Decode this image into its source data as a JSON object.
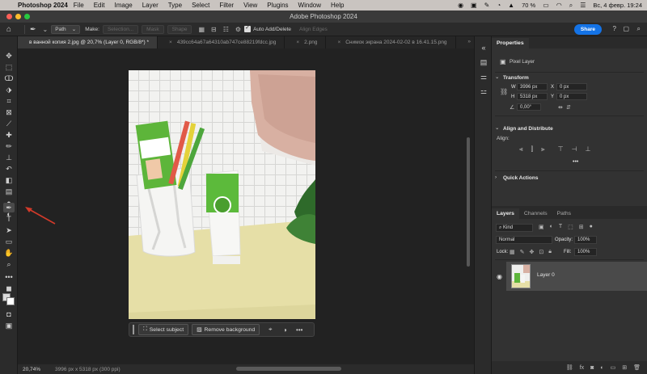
{
  "menubar": {
    "app_name": "Photoshop 2024",
    "items": [
      "File",
      "Edit",
      "Image",
      "Layer",
      "Type",
      "Select",
      "Filter",
      "View",
      "Plugins",
      "Window",
      "Help"
    ],
    "battery": "70 %",
    "datetime": "Вс, 4 февр.  19:24"
  },
  "window": {
    "title": "Adobe Photoshop 2024"
  },
  "options": {
    "path_mode": "Path",
    "make_label": "Make:",
    "selection_btn": "Selection...",
    "mask_btn": "Mask",
    "shape_btn": "Shape",
    "auto_add_delete": "Auto Add/Delete",
    "align_edges": "Align Edges",
    "share": "Share"
  },
  "doc_tabs": [
    "в ванной копия 2.jpg @ 20,7% (Layer 0, RGB/8*) *",
    "439cc64a67a64310ab747ce88219fdcc.jpg",
    "2.png",
    "Снимок экрана 2024-02-02 в 16.41.15.png"
  ],
  "contextual_bar": {
    "select_subject": "Select subject",
    "remove_background": "Remove background",
    "more": "•••"
  },
  "status": {
    "zoom": "20,74%",
    "dimensions": "3996 px x 5318 px (300 ppi)"
  },
  "properties": {
    "tab": "Properties",
    "layer_type": "Pixel Layer",
    "transform_title": "Transform",
    "w_label": "W",
    "w_value": "3996 px",
    "h_label": "H",
    "h_value": "5318 px",
    "x_label": "X",
    "x_value": "0 px",
    "y_label": "Y",
    "y_value": "0 px",
    "angle": "0,00°",
    "align_title": "Align and Distribute",
    "align_label": "Align:",
    "more": "•••",
    "quick_actions_title": "Quick Actions"
  },
  "layers": {
    "tabs": [
      "Layers",
      "Channels",
      "Paths"
    ],
    "kind": "Kind",
    "blend_mode": "Normal",
    "opacity_label": "Opacity:",
    "opacity": "100%",
    "lock_label": "Lock:",
    "fill_label": "Fill:",
    "fill": "100%",
    "layer_name": "Layer 0"
  },
  "colors": {
    "accent": "#1473e6",
    "arrow": "#d23a2a"
  }
}
